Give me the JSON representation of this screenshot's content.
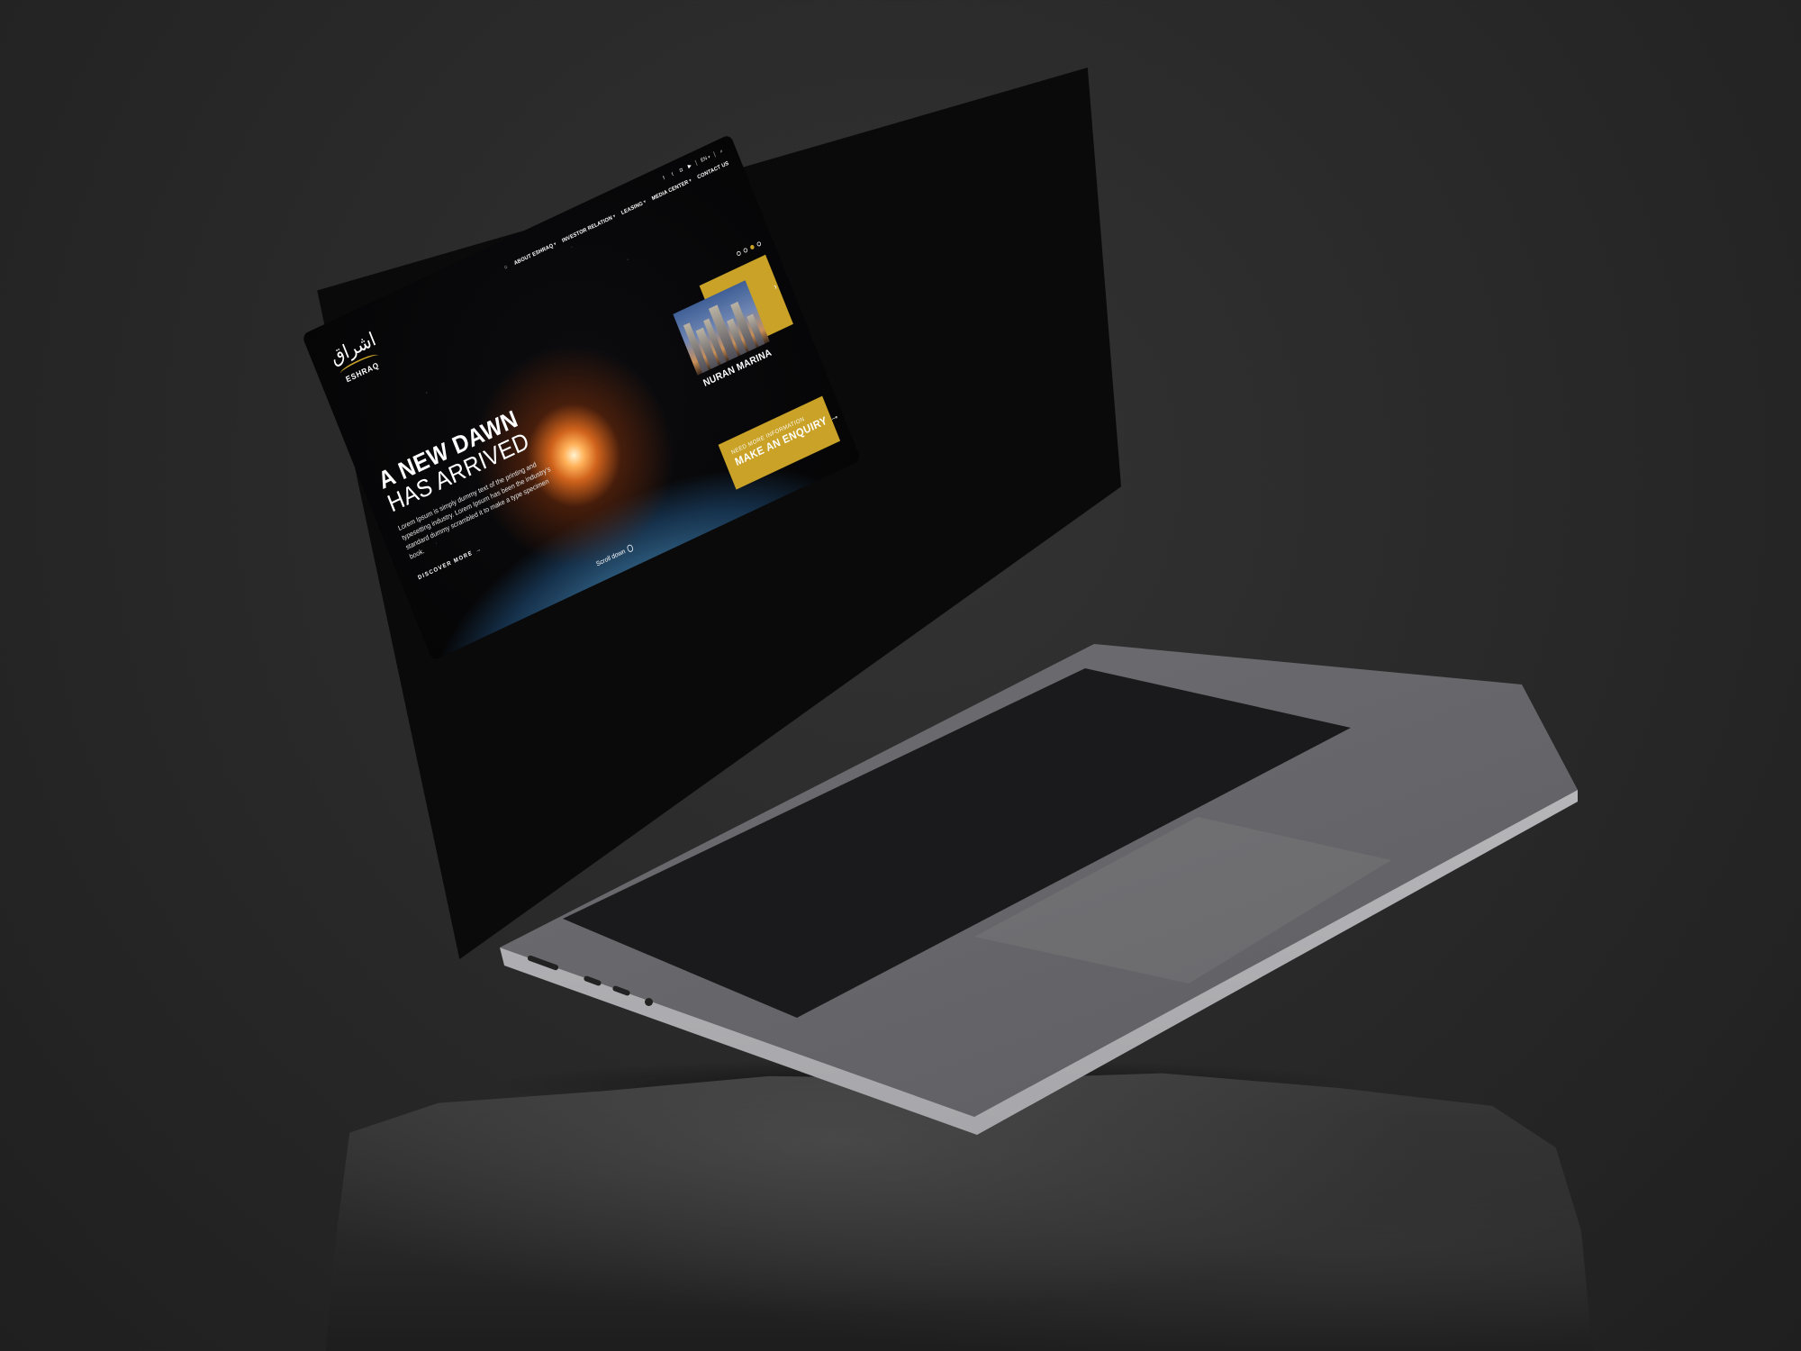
{
  "site": {
    "logo": {
      "arabic": "اشراق",
      "name": "ESHRAQ"
    },
    "topbar": {
      "social_icons": [
        "facebook-icon",
        "twitter-icon",
        "instagram-icon",
        "youtube-icon"
      ],
      "language": "EN",
      "search_icon": "search-icon"
    },
    "nav": [
      {
        "label": "ABOUT ESHRAQ",
        "has_dropdown": true
      },
      {
        "label": "INVESTOR RELATION",
        "has_dropdown": true
      },
      {
        "label": "LEASING",
        "has_dropdown": true
      },
      {
        "label": "MEDIA CENTER",
        "has_dropdown": true
      },
      {
        "label": "CONTACT US",
        "has_dropdown": false
      }
    ],
    "hero": {
      "title_line1": "A NEW DAWN",
      "title_line2": "HAS ARRIVED",
      "description": "Lorem Ipsum is simply dummy text of the printing and typesetting industry. Lorem Ipsum has been the industry's standard dummy scrambled it to make a type specimen book.",
      "cta": "DISCOVER MORE",
      "cta_arrow": "→"
    },
    "slider": {
      "count": 4,
      "active_index": 2
    },
    "project_card": {
      "title": "NURAN MARINA",
      "chevron": "›"
    },
    "enquiry": {
      "small_text": "NEED MORE INFORMATION",
      "big_text": "MAKE AN ENQUIRY",
      "arrow": "→"
    },
    "scroll": {
      "label": "Scroll down"
    }
  },
  "colors": {
    "accent_gold": "#c9a227",
    "background": "#2a2a2a"
  }
}
